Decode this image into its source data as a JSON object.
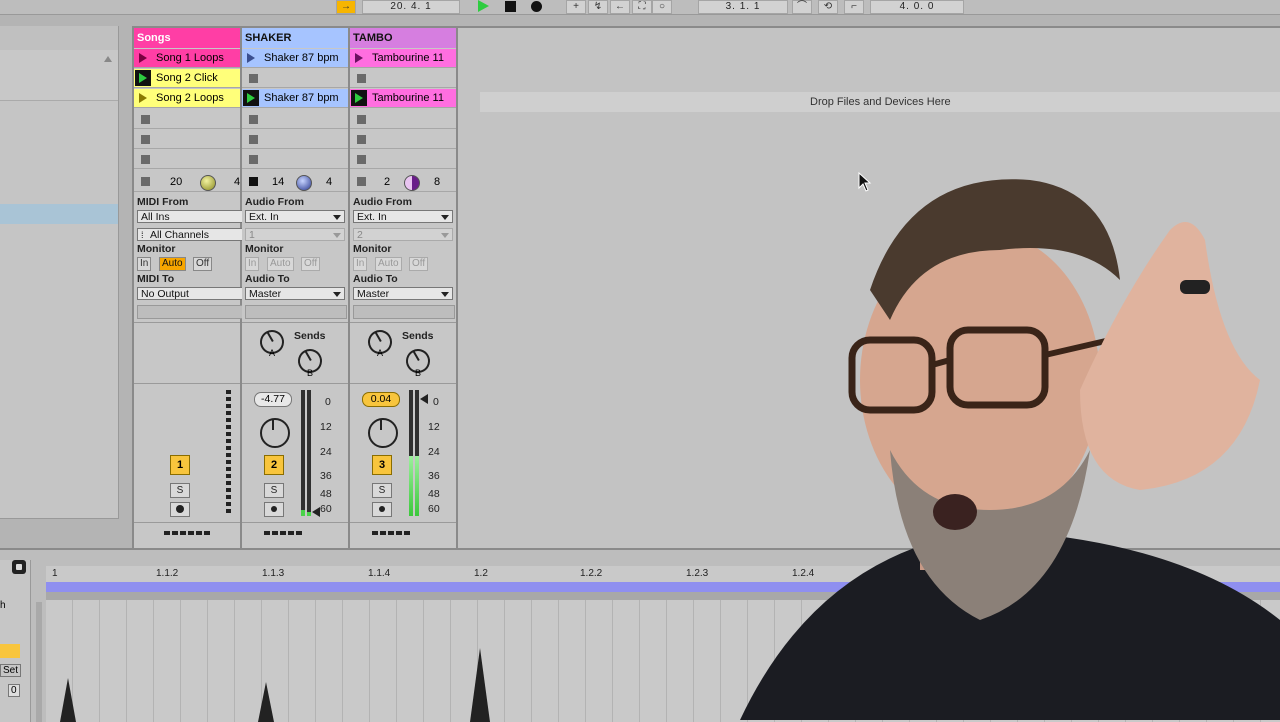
{
  "transport": {
    "position": "20.   4.   1",
    "loop_start": "3.   1.   1",
    "loop_length": "4.   0.   0"
  },
  "tracks": [
    {
      "name": "Songs",
      "color": "#ff3ea5",
      "clips": [
        "Song 1 Loops",
        "Song 2 Click",
        "Song 2 Loops"
      ],
      "clip_colors": [
        "#ff3ea5",
        "#ffff7a",
        "#ffff7a"
      ],
      "playing_index": 1,
      "status_left": "20",
      "status_right": "4",
      "io": {
        "from_label": "MIDI From",
        "from_value": "All Ins",
        "channel_value": "All Channels",
        "monitor_label": "Monitor",
        "monitor_in": "In",
        "monitor_auto": "Auto",
        "monitor_off": "Off",
        "to_label": "MIDI To",
        "to_value": "No Output"
      },
      "number": "1",
      "solo": "S"
    },
    {
      "name": "SHAKER",
      "color": "#a6c4ff",
      "clips": [
        "Shaker 87 bpm",
        "",
        "Shaker 87 bpm"
      ],
      "clip_colors": [
        "#a6c4ff",
        "",
        "#a6c4ff"
      ],
      "playing_index": 2,
      "status_left": "14",
      "status_right": "4",
      "io": {
        "from_label": "Audio From",
        "from_value": "Ext. In",
        "channel_value": "1",
        "monitor_label": "Monitor",
        "monitor_in": "In",
        "monitor_auto": "Auto",
        "monitor_off": "Off",
        "to_label": "Audio To",
        "to_value": "Master"
      },
      "sends_label": "Sends",
      "send_a": "A",
      "send_b": "B",
      "volume": "-4.77",
      "number": "2",
      "solo": "S"
    },
    {
      "name": "TAMBO",
      "color": "#d67ee0",
      "clips": [
        "Tambourine 11",
        "",
        "Tambourine 11"
      ],
      "clip_colors": [
        "#ff6ee0",
        "",
        "#ff6ee0"
      ],
      "playing_index": 2,
      "status_left": "2",
      "status_right": "8",
      "io": {
        "from_label": "Audio From",
        "from_value": "Ext. In",
        "channel_value": "2",
        "monitor_label": "Monitor",
        "monitor_in": "In",
        "monitor_auto": "Auto",
        "monitor_off": "Off",
        "to_label": "Audio To",
        "to_value": "Master"
      },
      "sends_label": "Sends",
      "send_a": "A",
      "send_b": "B",
      "volume": "0.04",
      "number": "3",
      "solo": "S"
    }
  ],
  "meter_scale": [
    "0",
    "12",
    "24",
    "36",
    "48",
    "60"
  ],
  "drop_zone_text": "Drop Files and Devices Here",
  "ruler": [
    "1",
    "1.1.2",
    "1.1.3",
    "1.1.4",
    "1.2",
    "1.2.2",
    "1.2.3",
    "1.2.4"
  ],
  "arrangement_left_labels": [
    "h",
    "Set",
    "0"
  ]
}
